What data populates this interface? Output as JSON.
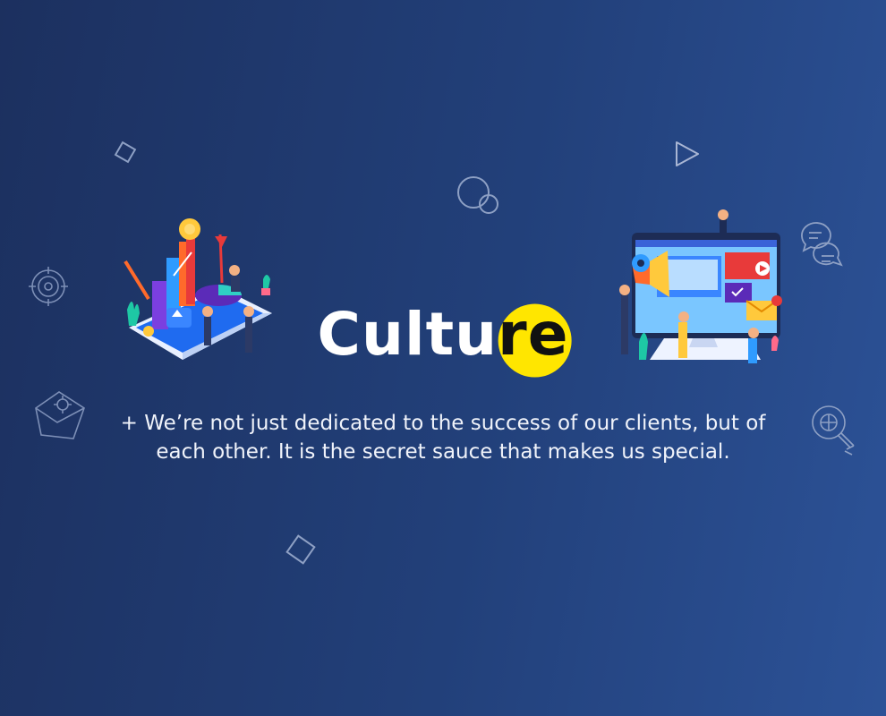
{
  "hero": {
    "title_main": "Cultu",
    "title_highlight": "re",
    "tagline": "+ We’re not just dedicated to the success of our clients, but of each other. It is the secret sauce that makes us special."
  },
  "colors": {
    "background_start": "#1c305f",
    "background_end": "#2c5297",
    "highlight": "#ffe600",
    "text": "#ffffff"
  },
  "decorations": [
    "diamond-outline-icon",
    "play-outline-icon",
    "circles-outline-icon",
    "target-outline-icon",
    "chat-bubbles-icon",
    "envelope-gear-icon",
    "lightbulb-globe-icon",
    "diamond-outline-icon"
  ],
  "illustrations": [
    "analytics-growth-illustration",
    "digital-marketing-illustration"
  ]
}
